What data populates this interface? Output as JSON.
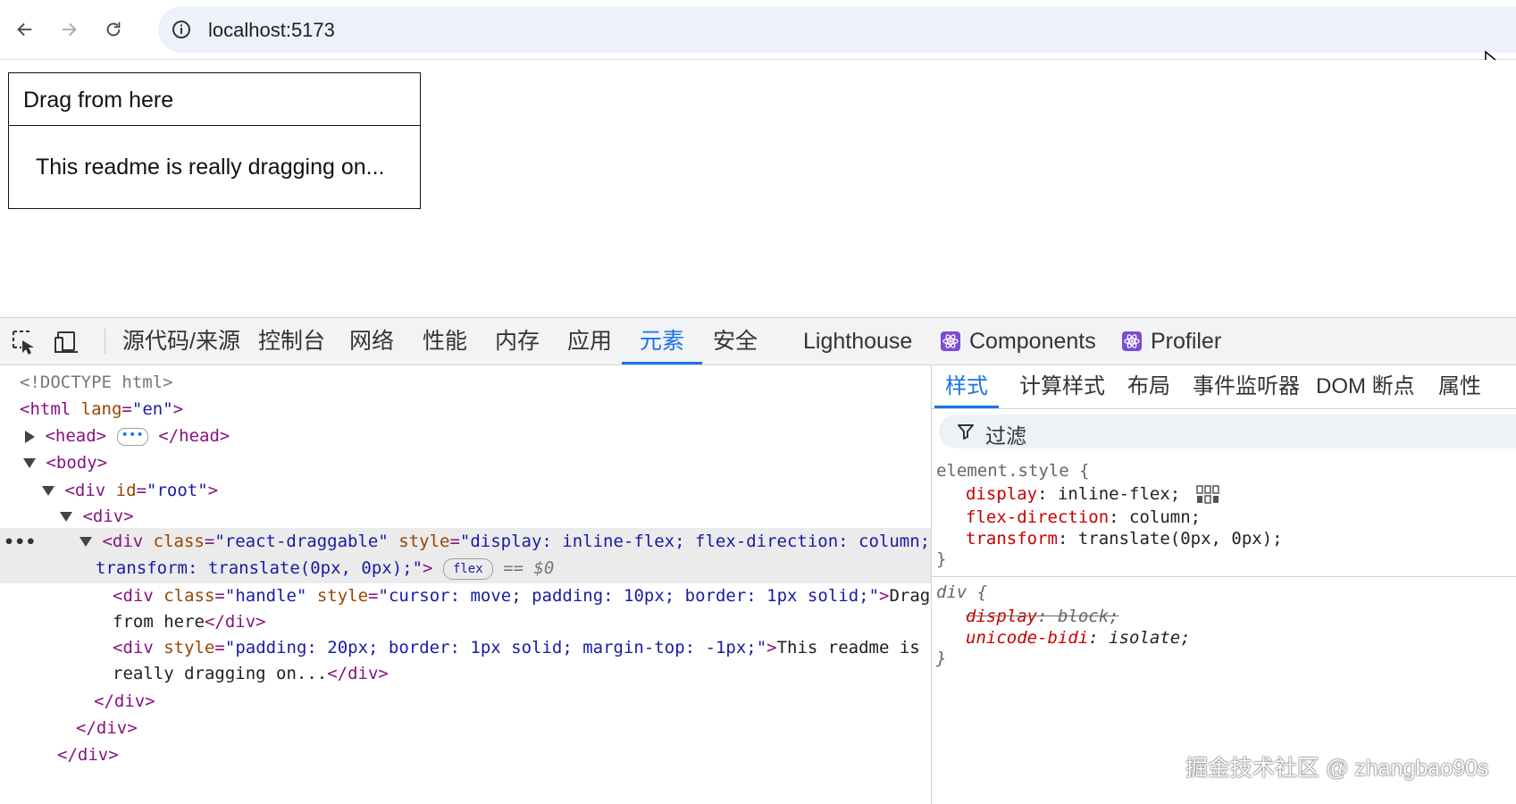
{
  "browser": {
    "url": "localhost:5173"
  },
  "page": {
    "handle_text": "Drag from here",
    "readme_text": "This readme is really dragging on..."
  },
  "devtools": {
    "tabs": [
      "源代码/来源",
      "控制台",
      "网络",
      "性能",
      "内存",
      "应用",
      "元素",
      "安全",
      "Lighthouse",
      "Components",
      "Profiler"
    ],
    "active_tab": "元素",
    "dom": {
      "doctype": "<!DOCTYPE html>",
      "html_open": "<html",
      "html_attr": "lang",
      "html_val": "\"en\"",
      "head_open": "<head>",
      "head_close": "</head>",
      "body_open": "<body>",
      "div_root_tag": "<div",
      "div_root_attr": "id",
      "div_root_val": "\"root\"",
      "div_open": "<div>",
      "sel_tag": "<div",
      "sel_class_attr": "class",
      "sel_class_val": "\"react-draggable\"",
      "sel_style_attr": "style",
      "sel_style_val1": "\"display: inline-flex; flex-direction: column;",
      "sel_style_val2": "transform: translate(0px, 0px);\"",
      "flex_badge": "flex",
      "dollar": "== $0",
      "handle_tag": "<div",
      "handle_class_attr": "class",
      "handle_class_val": "\"handle\"",
      "handle_style_attr": "style",
      "handle_style_val": "\"cursor: move; padding: 10px; border: 1px solid;\"",
      "handle_text1": "Drag",
      "handle_text2": "from here",
      "div_close": "</div>",
      "readme_tag": "<div",
      "readme_style_attr": "style",
      "readme_style_val": "\"padding: 20px; border: 1px solid; margin-top: -1px;\"",
      "readme_text1": "This readme is",
      "readme_text2": "really dragging on..."
    },
    "styles_tabs": [
      "样式",
      "计算样式",
      "布局",
      "事件监听器",
      "DOM 断点",
      "属性"
    ],
    "filter_placeholder": "过滤",
    "element_style": {
      "selector": "element.style {",
      "props": [
        {
          "name": "display",
          "value": "inline-flex;"
        },
        {
          "name": "flex-direction",
          "value": "column;"
        },
        {
          "name": "transform",
          "value": "translate(0px, 0px);"
        }
      ],
      "close": "}"
    },
    "ua_rule": {
      "selector": "div {",
      "props": [
        {
          "name": "display",
          "value": "block;",
          "overridden": true
        },
        {
          "name": "unicode-bidi",
          "value": "isolate;"
        }
      ],
      "close": "}"
    }
  },
  "watermark": "掘金技术社区 @ zhangbao90s"
}
